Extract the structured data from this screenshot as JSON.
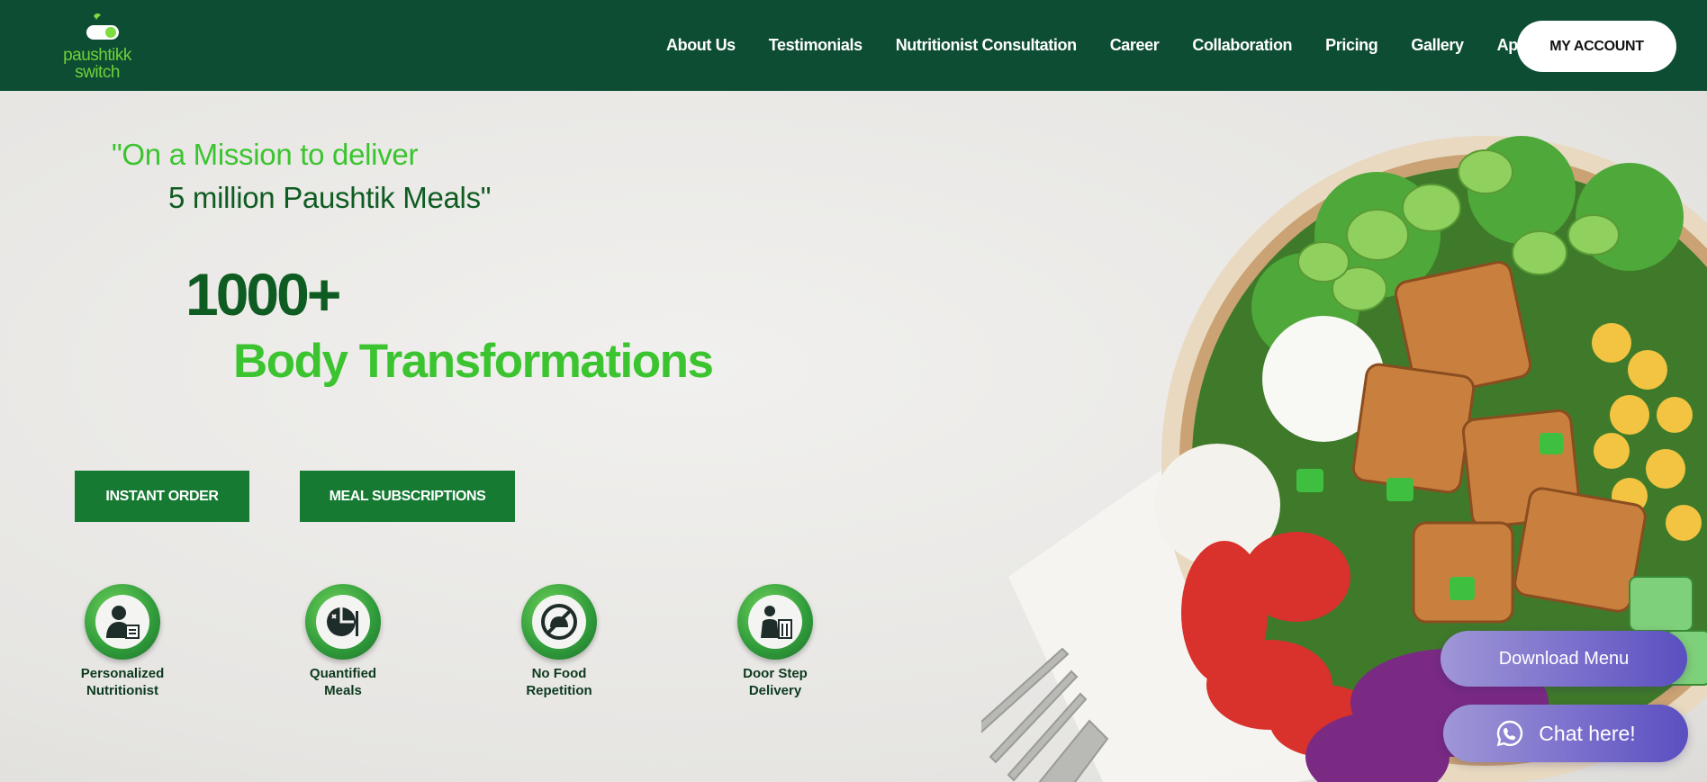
{
  "brand": {
    "name_line1": "paushtikk",
    "name_line2": "switch",
    "primary_color": "#0d4d33",
    "accent_green": "#3bc42f",
    "dark_green": "#0f5c22"
  },
  "nav": {
    "items": [
      "About Us",
      "Testimonials",
      "Nutritionist Consultation",
      "Career",
      "Collaboration",
      "Pricing",
      "Gallery",
      "App"
    ],
    "account_label": "MY ACCOUNT"
  },
  "hero": {
    "tagline_line1": "\"On a Mission to deliver",
    "tagline_line2": "5 million Paushtik Meals\"",
    "stat_number": "1000+",
    "stat_label": "Body Transformations",
    "instant_order_label": "INSTANT ORDER",
    "meal_subscriptions_label": "MEAL SUBSCRIPTIONS"
  },
  "features": [
    {
      "line1": "Personalized",
      "line2": "Nutritionist",
      "icon": "nutritionist-icon"
    },
    {
      "line1": "Quantified",
      "line2": "Meals",
      "icon": "quantified-meals-icon"
    },
    {
      "line1": "No Food",
      "line2": "Repetition",
      "icon": "no-repetition-icon"
    },
    {
      "line1": "Door Step",
      "line2": "Delivery",
      "icon": "delivery-icon"
    }
  ],
  "floating": {
    "download_menu_label": "Download Menu",
    "chat_label": "Chat here!",
    "chat_icon": "whatsapp-icon"
  }
}
